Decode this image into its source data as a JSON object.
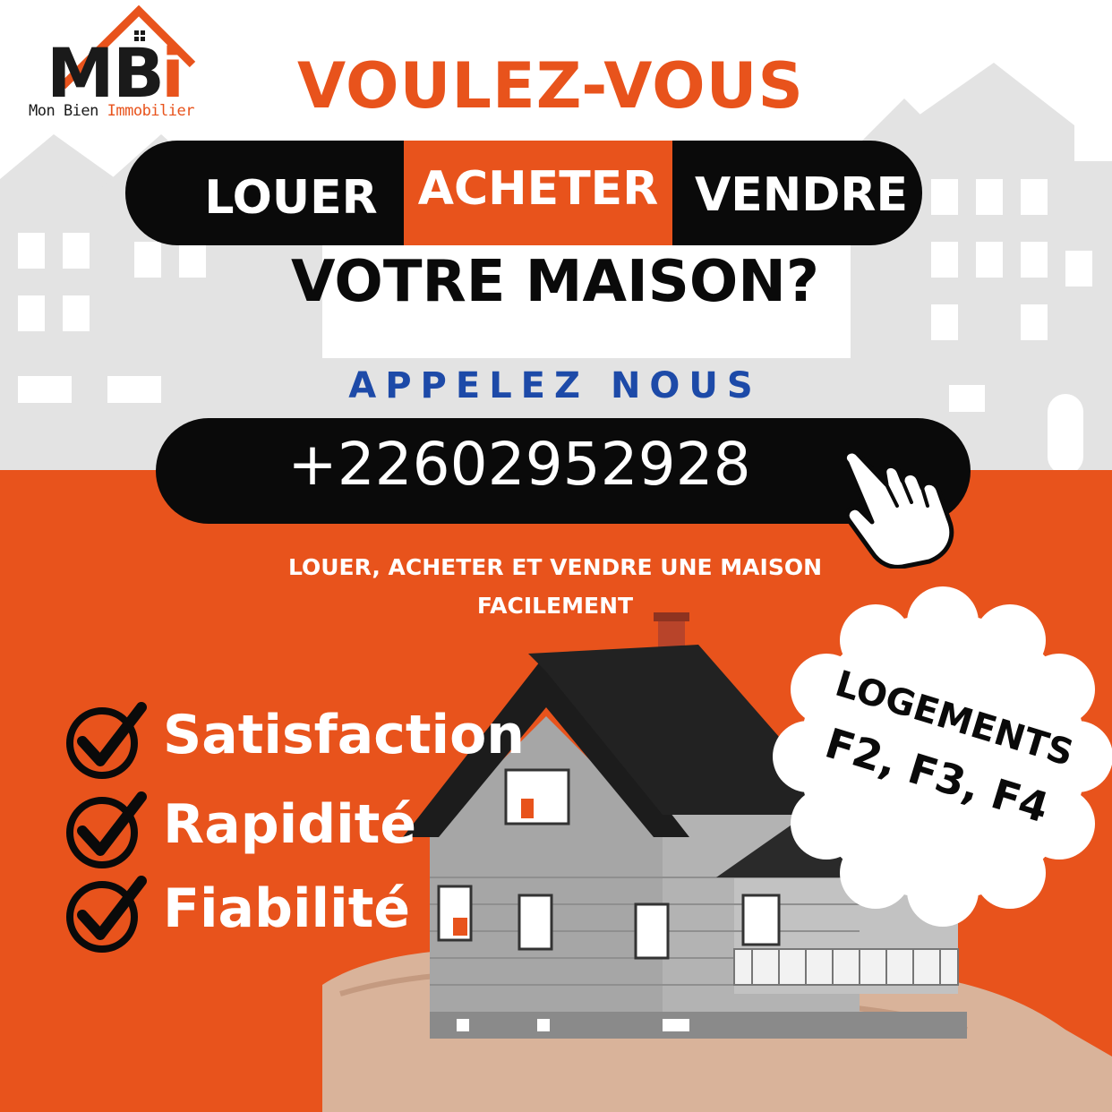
{
  "brand": {
    "logo_letters": "MBi",
    "name_part1": "Mon Bien ",
    "name_part2": "Immobilier"
  },
  "headline": "VOULEZ-VOUS",
  "options": {
    "louer": "LOUER",
    "acheter": "ACHETER",
    "vendre": "VENDRE"
  },
  "question": "VOTRE MAISON?",
  "call_label": "APPELEZ NOUS",
  "phone": "+22602952928",
  "tagline_line1": "LOUER, ACHETER ET VENDRE UNE MAISON",
  "tagline_line2": "FACILEMENT",
  "benefits": [
    "Satisfaction",
    "Rapidité",
    "Fiabilité"
  ],
  "badge": {
    "line1": "LOGEMENTS",
    "line2": "F2, F3, F4"
  },
  "colors": {
    "accent_orange": "#e8531c",
    "black": "#0a0a0a",
    "blue": "#1d4aa8",
    "city_grey": "#e2e2e2"
  },
  "icons": [
    "logo-house-icon",
    "hand-pointer-icon",
    "check-circle-icon",
    "house-on-hand-illustration"
  ]
}
